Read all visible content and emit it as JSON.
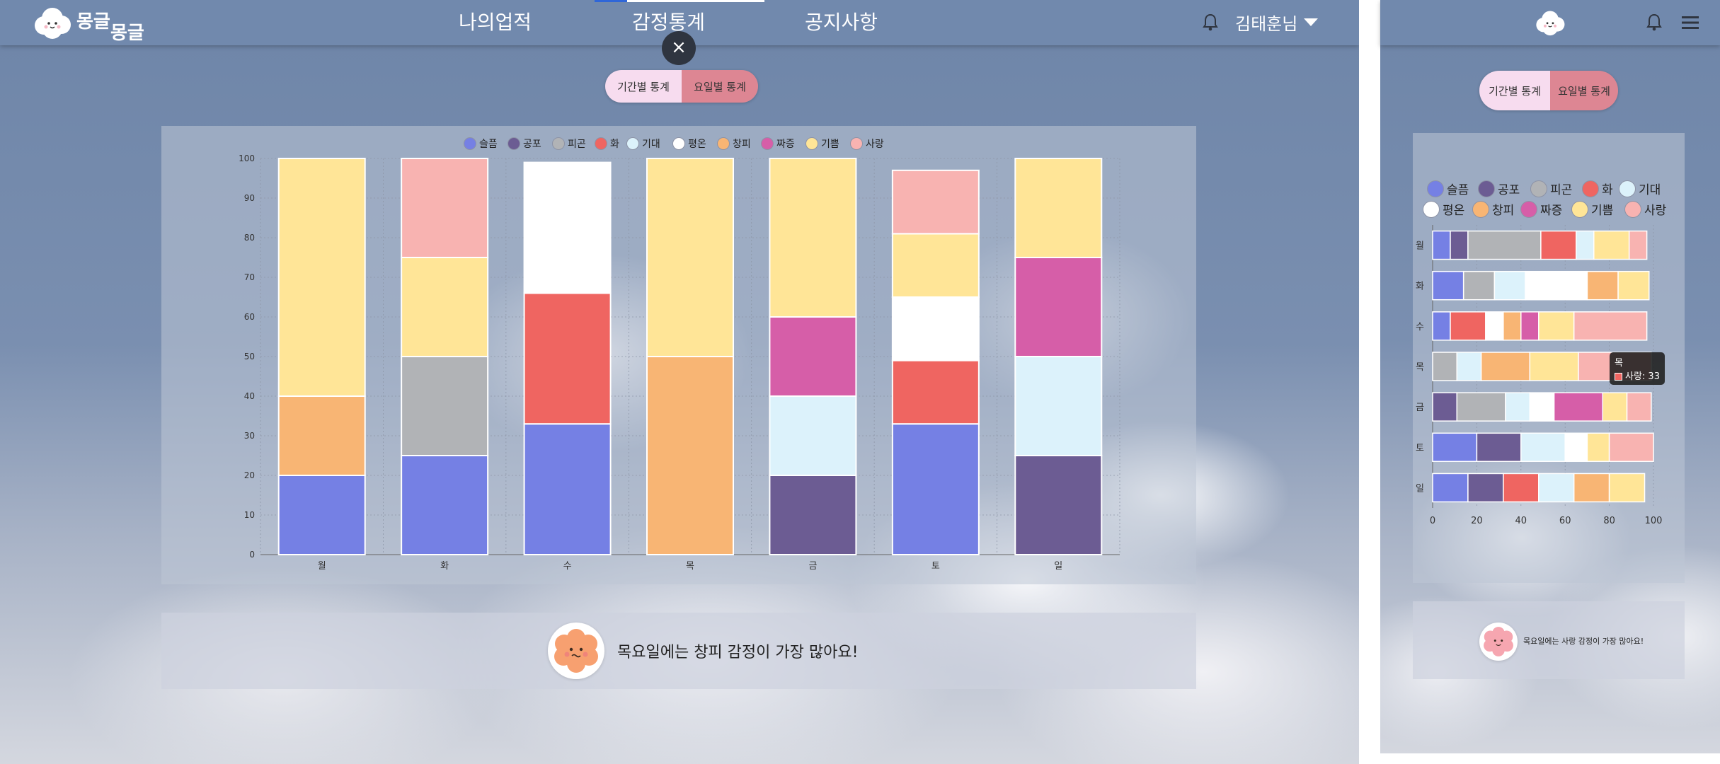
{
  "brand": {
    "logo_line1": "몽글",
    "logo_line2": "몽글"
  },
  "nav": {
    "items": [
      "나의업적",
      "감정통계",
      "공지사항"
    ],
    "user": "김태훈님"
  },
  "toggle": {
    "period": "기간별 통계",
    "weekday": "요일별 통계"
  },
  "close_label": "×",
  "emotions": [
    {
      "name": "슬픔",
      "color": "#7580e4"
    },
    {
      "name": "공포",
      "color": "#6c5c93"
    },
    {
      "name": "피곤",
      "color": "#b1b3b6"
    },
    {
      "name": "화",
      "color": "#ef6561"
    },
    {
      "name": "기대",
      "color": "#dcf2fb"
    },
    {
      "name": "평온",
      "color": "#ffffff"
    },
    {
      "name": "창피",
      "color": "#f8b574"
    },
    {
      "name": "짜증",
      "color": "#d65ea8"
    },
    {
      "name": "기쁨",
      "color": "#ffe597"
    },
    {
      "name": "사랑",
      "color": "#f8b3b1"
    }
  ],
  "chart_data": [
    {
      "type": "bar",
      "stacked": true,
      "orientation": "vertical",
      "categories": [
        "월",
        "화",
        "수",
        "목",
        "금",
        "토",
        "일"
      ],
      "ylim": [
        0,
        100
      ],
      "yticks": [
        0,
        10,
        20,
        30,
        40,
        50,
        60,
        70,
        80,
        90,
        100
      ],
      "grid": true,
      "legend": "top",
      "series": [
        {
          "name": "슬픔",
          "values": [
            20,
            25,
            33,
            0,
            0,
            33,
            0
          ]
        },
        {
          "name": "공포",
          "values": [
            0,
            0,
            0,
            0,
            20,
            0,
            25
          ]
        },
        {
          "name": "피곤",
          "values": [
            0,
            25,
            0,
            0,
            0,
            0,
            0
          ]
        },
        {
          "name": "화",
          "values": [
            0,
            0,
            33,
            0,
            0,
            16,
            0
          ]
        },
        {
          "name": "기대",
          "values": [
            0,
            0,
            0,
            0,
            20,
            0,
            25
          ]
        },
        {
          "name": "평온",
          "values": [
            0,
            0,
            33,
            0,
            0,
            16,
            0
          ]
        },
        {
          "name": "창피",
          "values": [
            20,
            0,
            0,
            50,
            0,
            0,
            0
          ]
        },
        {
          "name": "짜증",
          "values": [
            0,
            0,
            0,
            0,
            20,
            0,
            25
          ]
        },
        {
          "name": "기쁨",
          "values": [
            60,
            25,
            0,
            50,
            40,
            16,
            25
          ]
        },
        {
          "name": "사랑",
          "values": [
            0,
            25,
            0,
            0,
            0,
            16,
            0
          ]
        }
      ]
    },
    {
      "type": "bar",
      "stacked": true,
      "orientation": "horizontal",
      "categories": [
        "월",
        "화",
        "수",
        "목",
        "금",
        "토",
        "일"
      ],
      "xlim": [
        0,
        100
      ],
      "xticks": [
        0,
        20,
        40,
        60,
        80,
        100
      ],
      "grid": true,
      "legend": "top",
      "series": [
        {
          "name": "슬픔",
          "values": [
            8,
            14,
            8,
            0,
            0,
            20,
            16
          ]
        },
        {
          "name": "공포",
          "values": [
            8,
            0,
            0,
            0,
            11,
            20,
            16
          ]
        },
        {
          "name": "피곤",
          "values": [
            33,
            14,
            0,
            11,
            22,
            0,
            0
          ]
        },
        {
          "name": "화",
          "values": [
            16,
            0,
            16,
            0,
            0,
            0,
            16
          ]
        },
        {
          "name": "기대",
          "values": [
            8,
            14,
            0,
            11,
            11,
            20,
            16
          ]
        },
        {
          "name": "평온",
          "values": [
            0,
            28,
            8,
            0,
            11,
            10,
            0
          ]
        },
        {
          "name": "창피",
          "values": [
            0,
            14,
            8,
            22,
            0,
            0,
            16
          ]
        },
        {
          "name": "짜증",
          "values": [
            0,
            0,
            8,
            0,
            22,
            0,
            0
          ]
        },
        {
          "name": "기쁨",
          "values": [
            16,
            14,
            16,
            22,
            11,
            10,
            16
          ]
        },
        {
          "name": "사랑",
          "values": [
            8,
            0,
            33,
            33,
            11,
            20,
            0
          ]
        }
      ]
    }
  ],
  "message": {
    "desktop": "목요일에는 창피 감정이 가장 많아요!",
    "mobile": "목요일에는 사랑 감정이 가장 많아요!"
  },
  "tooltip": {
    "title": "목",
    "label": "사랑: 33"
  }
}
